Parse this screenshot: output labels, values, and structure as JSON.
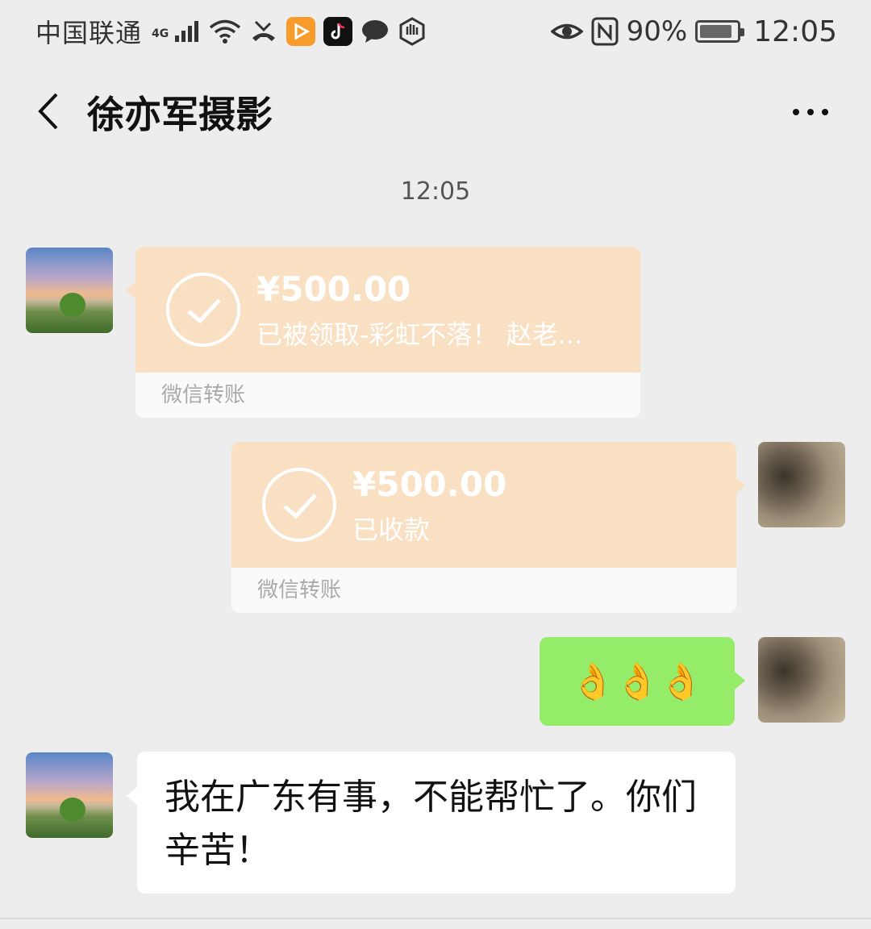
{
  "status_bar": {
    "carrier": "中国联通",
    "network": "4G",
    "battery_percent": "90%",
    "time": "12:05",
    "icons": [
      "signal-icon",
      "wifi-icon",
      "missed-call-icon",
      "video-app-icon",
      "tiktok-icon",
      "message-icon",
      "hand-icon",
      "eye-icon",
      "nfc-icon",
      "battery-icon"
    ]
  },
  "header": {
    "title": "徐亦军摄影",
    "back_icon": "chevron-left-icon",
    "more_icon": "more-icon"
  },
  "chat": {
    "timestamp": "12:05",
    "messages": [
      {
        "side": "left",
        "type": "transfer",
        "amount": "¥500.00",
        "note": "已被领取-彩虹不落！ 赵老...",
        "footer": "微信转账"
      },
      {
        "side": "right",
        "type": "transfer",
        "amount": "¥500.00",
        "note": "已收款",
        "footer": "微信转账"
      },
      {
        "side": "right",
        "type": "emoji",
        "text": "👌👌👌"
      },
      {
        "side": "left",
        "type": "text",
        "line1": "我在广东有事，不能帮忙了。你们",
        "line2": "辛苦！"
      }
    ]
  },
  "colors": {
    "background": "#ededed",
    "transfer_bg": "#fae0c3",
    "sent_bubble": "#95ec69",
    "received_bubble": "#ffffff"
  }
}
